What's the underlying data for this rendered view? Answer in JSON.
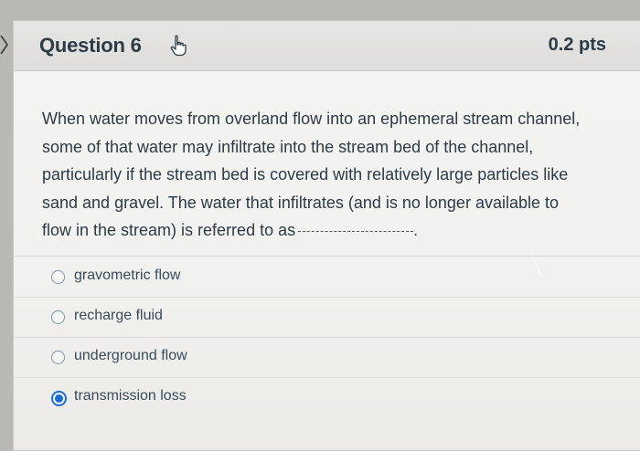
{
  "question": {
    "title": "Question 6",
    "points": "0.2 pts",
    "text_lines": [
      "When water moves from overland flow into an ephemeral stream channel,",
      "some of that water may infiltrate into the stream bed of the channel,",
      "particularly if the stream bed is covered with relatively large particles like",
      "sand and gravel.  The water that infiltrates (and is no longer available to",
      "flow in the stream) is referred to as"
    ],
    "blank_end": "."
  },
  "answers": [
    {
      "label": "gravometric flow",
      "selected": false
    },
    {
      "label": "recharge fluid",
      "selected": false
    },
    {
      "label": "underground flow",
      "selected": false
    },
    {
      "label": "transmission loss",
      "selected": true
    }
  ],
  "icons": {
    "cursor": "hand-pointer-icon",
    "chevron": "chevron-right-icon"
  },
  "colors": {
    "text": "#2d3b45",
    "header_bg": "#e0e0de",
    "selected_radio": "#1b6ed1",
    "radio_border": "#7c96b0"
  }
}
